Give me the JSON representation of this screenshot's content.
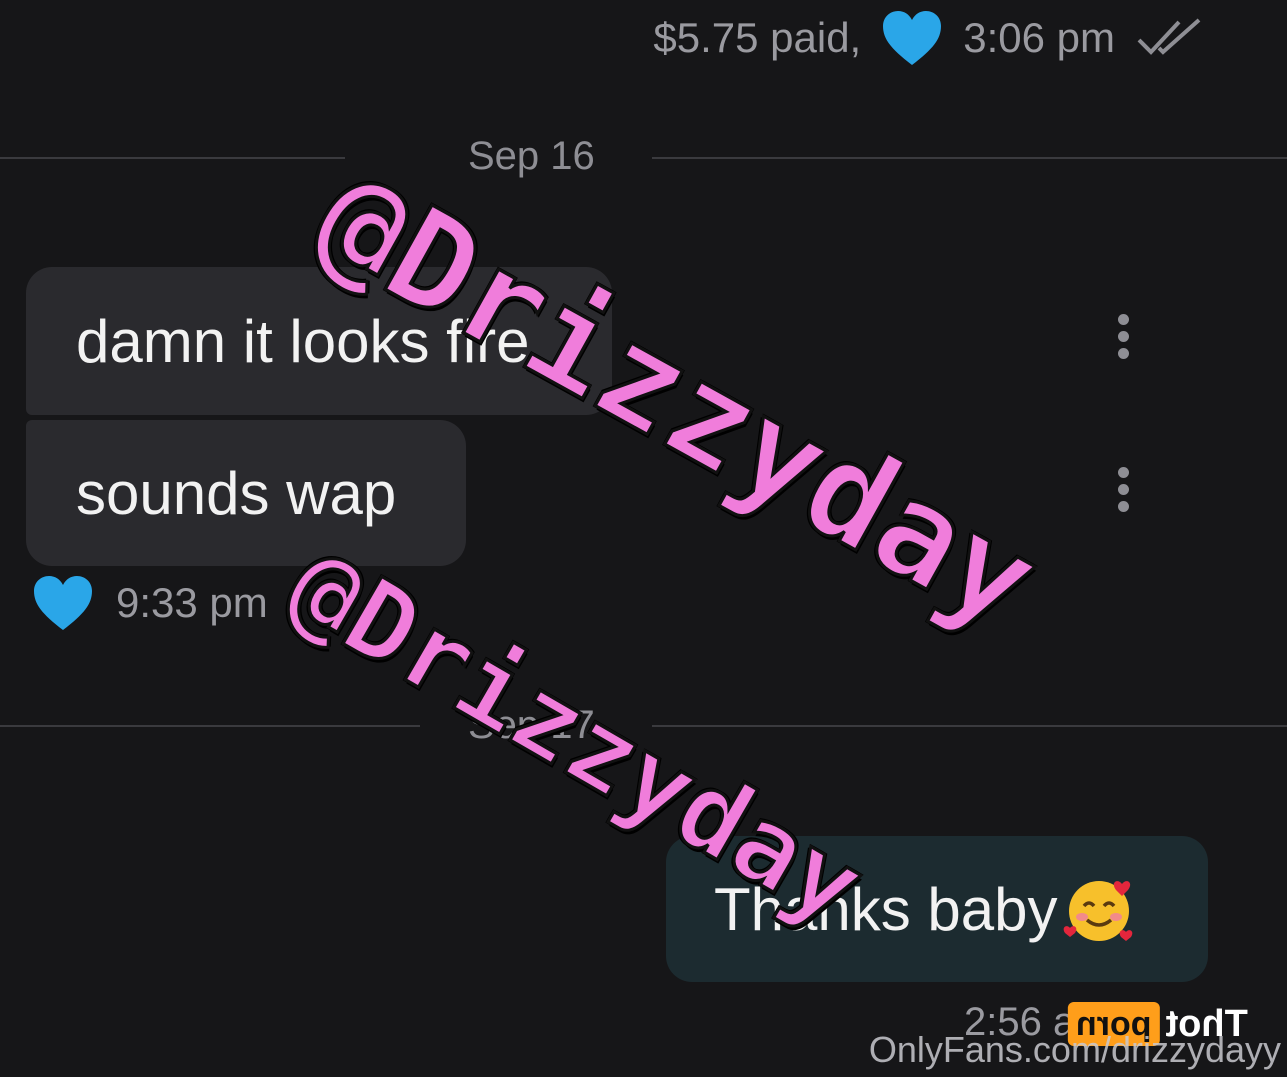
{
  "top_meta": {
    "paid_text": "$5.75 paid,",
    "time": "3:06 pm"
  },
  "dates": {
    "first": "Sep 16",
    "second": "Sep 17"
  },
  "messages": {
    "incoming": [
      {
        "text": "damn it looks fire"
      },
      {
        "text": "sounds wap"
      }
    ],
    "incoming_time": "9:33 pm",
    "outgoing": [
      {
        "text": "Thanks baby"
      }
    ],
    "outgoing_time": "2:56 am"
  },
  "watermarks": [
    "@Drizzyday",
    "@Drizzyday"
  ],
  "footer": {
    "url": "OnlyFans.com/drizzydayy",
    "brand_left": "Thot",
    "brand_box": "porn"
  },
  "colors": {
    "background": "#161618",
    "incoming_bubble": "#2a2a2e",
    "outgoing_bubble": "#1c2b30",
    "heart": "#2aa6e8",
    "watermark": "#f07ddb",
    "brand_box": "#ff9e1a"
  },
  "icons": [
    "heart-icon",
    "double-check-icon",
    "more-options-icon",
    "smiling-face-with-hearts-emoji"
  ]
}
